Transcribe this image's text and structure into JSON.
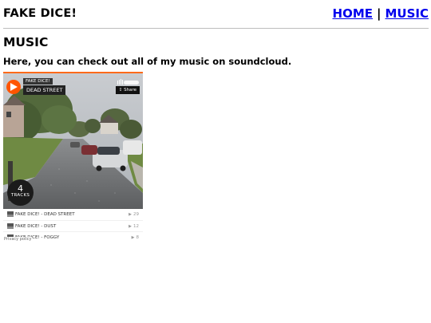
{
  "site": {
    "title": "FAKE DICE!",
    "nav": [
      {
        "label": "HOME"
      },
      {
        "label": "MUSIC"
      }
    ],
    "nav_separator": "|"
  },
  "main": {
    "title": "MUSIC",
    "intro": "Here, you can check out all of my music on soundcloud."
  },
  "player": {
    "accent_color": "#ff5500",
    "artist": "FAKE DICE!",
    "current_track": "DEAD STREET",
    "share_label": "Share",
    "tracks_count": "4",
    "tracks_label": "TRACKS",
    "tracks": [
      {
        "title": "FAKE DICE! - DEAD STREET",
        "plays": "29"
      },
      {
        "title": "FAKE DICE! - DUST",
        "plays": "12"
      },
      {
        "title": "FAKE DICE! - FOGGY",
        "plays": "8"
      }
    ],
    "privacy_label": "Privacy policy"
  }
}
